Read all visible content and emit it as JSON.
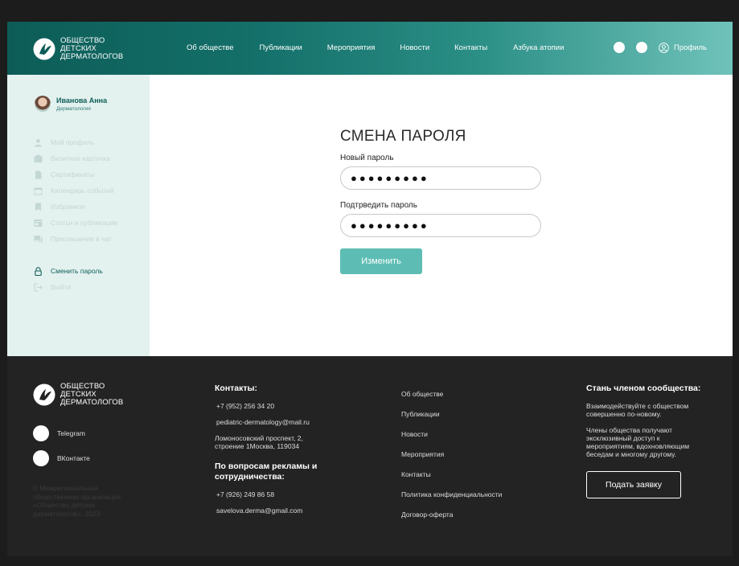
{
  "logo": {
    "line1": "ОБЩЕСТВО",
    "line2": "ДЕТСКИХ",
    "line3": "ДЕРМАТОЛОГОВ"
  },
  "nav": {
    "items": [
      "Об обществе",
      "Публикации",
      "Мероприятия",
      "Новости",
      "Контакты",
      "Азбука атопии"
    ]
  },
  "header": {
    "profile_label": "Профиль"
  },
  "user": {
    "name": "Иванова Анна",
    "role": "Дерматология"
  },
  "sidebar": {
    "items": [
      {
        "label": "Мой профиль",
        "icon": "user-icon"
      },
      {
        "label": "Визитная карточка",
        "icon": "card-icon"
      },
      {
        "label": "Сертификаты",
        "icon": "document-icon"
      },
      {
        "label": "Календарь событий",
        "icon": "calendar-icon"
      },
      {
        "label": "Избранное",
        "icon": "bookmark-icon"
      },
      {
        "label": "Статьи и публикации",
        "icon": "articles-icon"
      },
      {
        "label": "Приглашение в чат",
        "icon": "chat-icon"
      }
    ],
    "change_password": "Сменить пароль",
    "logout": "Выйти"
  },
  "form": {
    "title": "СМЕНА ПАРОЛЯ",
    "new_label": "Новый пароль",
    "new_value": "●●●●●●●●●",
    "confirm_label": "Подтрведить пароль",
    "confirm_value": "●●●●●●●●●",
    "submit": "Изменить"
  },
  "footer": {
    "social": {
      "telegram": "Telegram",
      "vk": "ВКонтакте"
    },
    "copyright": "© Межрегиональная общественная организация «Общество детских дерматологов», 2023",
    "contacts_title": "Контакты:",
    "phone": "+7 (952) 256 34 20",
    "email": "pediatric-dermatology@mail.ru",
    "address": "Ломоносовский проспект, 2, строение 1Москва, 119034",
    "ads_title": "По вопросам рекламы и сотрудничества:",
    "ads_phone": "+7 (926) 249 86 58",
    "ads_email": "savelova.derma@gmail.com",
    "links": [
      "Об обществе",
      "Публикации",
      "Новости",
      "Мероприятия",
      "Контакты",
      "Политика конфиденциальности",
      "Договор-оферта"
    ],
    "join_title": "Стань членом сообщества:",
    "join_text1": "Взаимодействуйте с обществом совершенно по-новому.",
    "join_text2": "Члены общества получают эксклюзивный доступ к мероприятиям, вдохновляющим беседам и многому другому.",
    "join_button": "Подать заявку"
  }
}
